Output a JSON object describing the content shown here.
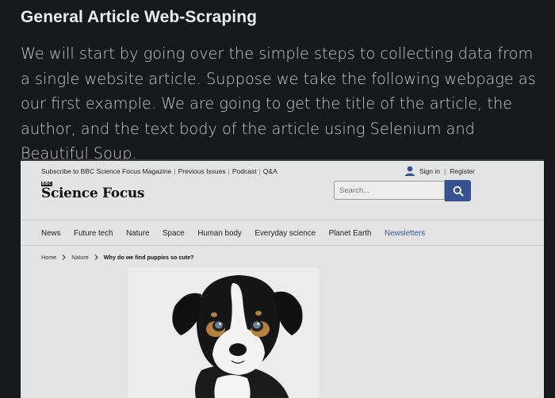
{
  "article": {
    "heading": "General Article Web-Scraping",
    "paragraph": "We will start by going over the simple steps to collecting data from a single website article. Suppose we take the following webpage as our first example. We are going to get the title of the article, the author, and the text body of the article using Selenium and Beautiful Soup."
  },
  "site": {
    "util_links": [
      "Subscribe to BBC Science Focus Magazine",
      "Previous Issues",
      "Podcast",
      "Q&A"
    ],
    "sign_in": "Sign in",
    "register": "Register",
    "logo_small": "BBC",
    "logo_text": "Science Focus",
    "search_placeholder": "Search...",
    "nav": [
      "News",
      "Future tech",
      "Nature",
      "Space",
      "Human body",
      "Everyday science",
      "Planet Earth",
      "Newsletters"
    ],
    "active_nav": "Newsletters",
    "breadcrumb": {
      "home": "Home",
      "section": "Nature",
      "current": "Why do we find puppies so cute?"
    },
    "icons": [
      "user-icon",
      "search-icon",
      "chevron-right-icon"
    ],
    "colors": {
      "accent": "#37528f",
      "nav_active": "#35568f"
    }
  }
}
